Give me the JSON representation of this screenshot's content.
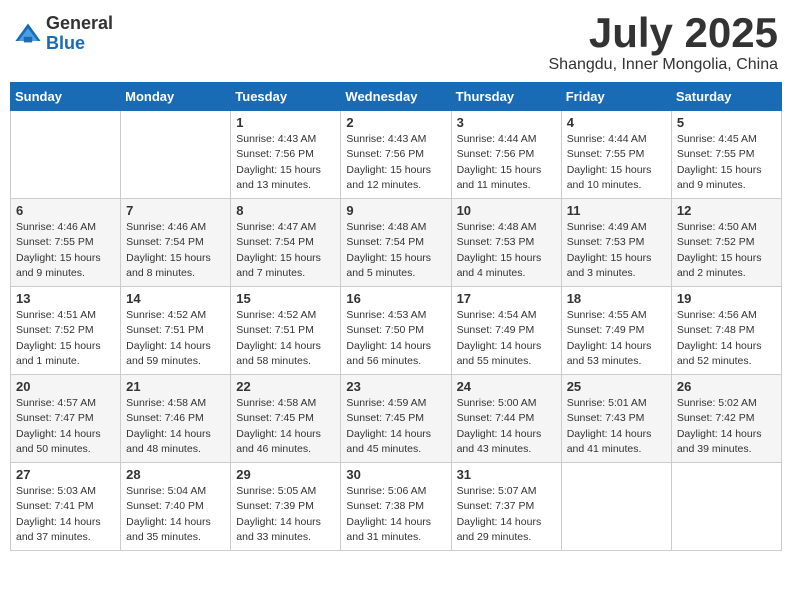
{
  "logo": {
    "general": "General",
    "blue": "Blue"
  },
  "title": "July 2025",
  "location": "Shangdu, Inner Mongolia, China",
  "days_header": [
    "Sunday",
    "Monday",
    "Tuesday",
    "Wednesday",
    "Thursday",
    "Friday",
    "Saturday"
  ],
  "weeks": [
    [
      {
        "day": "",
        "info": ""
      },
      {
        "day": "",
        "info": ""
      },
      {
        "day": "1",
        "info": "Sunrise: 4:43 AM\nSunset: 7:56 PM\nDaylight: 15 hours\nand 13 minutes."
      },
      {
        "day": "2",
        "info": "Sunrise: 4:43 AM\nSunset: 7:56 PM\nDaylight: 15 hours\nand 12 minutes."
      },
      {
        "day": "3",
        "info": "Sunrise: 4:44 AM\nSunset: 7:56 PM\nDaylight: 15 hours\nand 11 minutes."
      },
      {
        "day": "4",
        "info": "Sunrise: 4:44 AM\nSunset: 7:55 PM\nDaylight: 15 hours\nand 10 minutes."
      },
      {
        "day": "5",
        "info": "Sunrise: 4:45 AM\nSunset: 7:55 PM\nDaylight: 15 hours\nand 9 minutes."
      }
    ],
    [
      {
        "day": "6",
        "info": "Sunrise: 4:46 AM\nSunset: 7:55 PM\nDaylight: 15 hours\nand 9 minutes."
      },
      {
        "day": "7",
        "info": "Sunrise: 4:46 AM\nSunset: 7:54 PM\nDaylight: 15 hours\nand 8 minutes."
      },
      {
        "day": "8",
        "info": "Sunrise: 4:47 AM\nSunset: 7:54 PM\nDaylight: 15 hours\nand 7 minutes."
      },
      {
        "day": "9",
        "info": "Sunrise: 4:48 AM\nSunset: 7:54 PM\nDaylight: 15 hours\nand 5 minutes."
      },
      {
        "day": "10",
        "info": "Sunrise: 4:48 AM\nSunset: 7:53 PM\nDaylight: 15 hours\nand 4 minutes."
      },
      {
        "day": "11",
        "info": "Sunrise: 4:49 AM\nSunset: 7:53 PM\nDaylight: 15 hours\nand 3 minutes."
      },
      {
        "day": "12",
        "info": "Sunrise: 4:50 AM\nSunset: 7:52 PM\nDaylight: 15 hours\nand 2 minutes."
      }
    ],
    [
      {
        "day": "13",
        "info": "Sunrise: 4:51 AM\nSunset: 7:52 PM\nDaylight: 15 hours\nand 1 minute."
      },
      {
        "day": "14",
        "info": "Sunrise: 4:52 AM\nSunset: 7:51 PM\nDaylight: 14 hours\nand 59 minutes."
      },
      {
        "day": "15",
        "info": "Sunrise: 4:52 AM\nSunset: 7:51 PM\nDaylight: 14 hours\nand 58 minutes."
      },
      {
        "day": "16",
        "info": "Sunrise: 4:53 AM\nSunset: 7:50 PM\nDaylight: 14 hours\nand 56 minutes."
      },
      {
        "day": "17",
        "info": "Sunrise: 4:54 AM\nSunset: 7:49 PM\nDaylight: 14 hours\nand 55 minutes."
      },
      {
        "day": "18",
        "info": "Sunrise: 4:55 AM\nSunset: 7:49 PM\nDaylight: 14 hours\nand 53 minutes."
      },
      {
        "day": "19",
        "info": "Sunrise: 4:56 AM\nSunset: 7:48 PM\nDaylight: 14 hours\nand 52 minutes."
      }
    ],
    [
      {
        "day": "20",
        "info": "Sunrise: 4:57 AM\nSunset: 7:47 PM\nDaylight: 14 hours\nand 50 minutes."
      },
      {
        "day": "21",
        "info": "Sunrise: 4:58 AM\nSunset: 7:46 PM\nDaylight: 14 hours\nand 48 minutes."
      },
      {
        "day": "22",
        "info": "Sunrise: 4:58 AM\nSunset: 7:45 PM\nDaylight: 14 hours\nand 46 minutes."
      },
      {
        "day": "23",
        "info": "Sunrise: 4:59 AM\nSunset: 7:45 PM\nDaylight: 14 hours\nand 45 minutes."
      },
      {
        "day": "24",
        "info": "Sunrise: 5:00 AM\nSunset: 7:44 PM\nDaylight: 14 hours\nand 43 minutes."
      },
      {
        "day": "25",
        "info": "Sunrise: 5:01 AM\nSunset: 7:43 PM\nDaylight: 14 hours\nand 41 minutes."
      },
      {
        "day": "26",
        "info": "Sunrise: 5:02 AM\nSunset: 7:42 PM\nDaylight: 14 hours\nand 39 minutes."
      }
    ],
    [
      {
        "day": "27",
        "info": "Sunrise: 5:03 AM\nSunset: 7:41 PM\nDaylight: 14 hours\nand 37 minutes."
      },
      {
        "day": "28",
        "info": "Sunrise: 5:04 AM\nSunset: 7:40 PM\nDaylight: 14 hours\nand 35 minutes."
      },
      {
        "day": "29",
        "info": "Sunrise: 5:05 AM\nSunset: 7:39 PM\nDaylight: 14 hours\nand 33 minutes."
      },
      {
        "day": "30",
        "info": "Sunrise: 5:06 AM\nSunset: 7:38 PM\nDaylight: 14 hours\nand 31 minutes."
      },
      {
        "day": "31",
        "info": "Sunrise: 5:07 AM\nSunset: 7:37 PM\nDaylight: 14 hours\nand 29 minutes."
      },
      {
        "day": "",
        "info": ""
      },
      {
        "day": "",
        "info": ""
      }
    ]
  ]
}
